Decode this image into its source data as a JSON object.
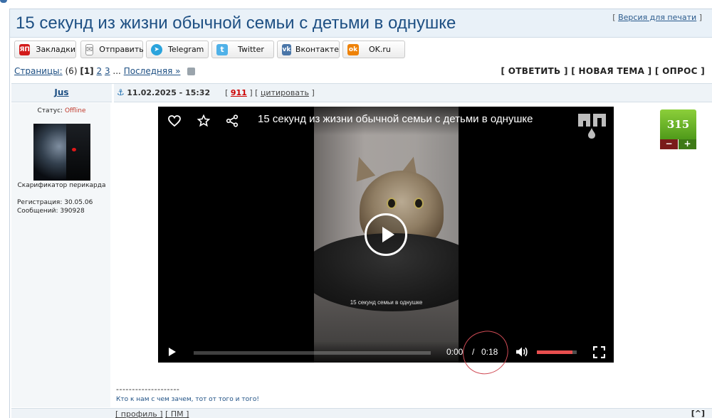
{
  "topic": {
    "title": "15 секунд из жизни обычной семьи с детьми в однушке",
    "print_bracket_open": "[",
    "print_label": "Версия для печати",
    "print_bracket_close": "]"
  },
  "share": [
    {
      "label": "Закладки",
      "icon": "yap-logo-icon",
      "icon_glyph": "ЯП",
      "color": "#d21b1b"
    },
    {
      "label": "Отправить",
      "icon": "envelope-icon",
      "icon_glyph": "✉",
      "color": "#7d7d7d"
    },
    {
      "label": "Telegram",
      "icon": "telegram-icon",
      "icon_glyph": "➤",
      "color": "#2aa3dc"
    },
    {
      "label": "Twitter",
      "icon": "twitter-icon",
      "icon_glyph": "t",
      "color": "#4fb1e8"
    },
    {
      "label": "Вконтакте",
      "icon": "vk-icon",
      "icon_glyph": "vk",
      "color": "#4a76a8"
    },
    {
      "label": "OK.ru",
      "icon": "odnoklassniki-icon",
      "icon_glyph": "ok",
      "color": "#ee8208"
    }
  ],
  "pager": {
    "label": "Страницы:",
    "count": "(6)",
    "current": "[1]",
    "page2": "2",
    "page3": "3",
    "ellipsis": "...",
    "last": "Последняя »"
  },
  "actions": "[ ОТВЕТИТЬ ] [ НОВАЯ ТЕМА ] [ ОПРОС ]",
  "post": {
    "author": "Jus",
    "anchor": "⚓",
    "date": "11.02.2025 - 15:32",
    "num_open": "[",
    "number": "911",
    "num_close": "]",
    "quote_open": "[",
    "quote_label": "цитировать",
    "quote_close": "]"
  },
  "user": {
    "status_label": "Статус:",
    "status_value": "Offline",
    "rank": "Скарификатор перикарда",
    "registration": "Регистрация: 30.05.06",
    "messages": "Сообщений: 390928"
  },
  "video": {
    "title": "15 секунд из жизни обычной семьи с детьми в однушке",
    "caption": "15 секунд семьи в однушке",
    "current_time": "0:00",
    "time_sep": "/",
    "duration": "0:18",
    "progress": 0,
    "volume": 0.9,
    "volume_color": "#e84f4f"
  },
  "rating": {
    "score": "315",
    "minus": "−",
    "plus": "+"
  },
  "signature": {
    "line": "--------------------",
    "text": "Кто к нам с чем зачем, тот от того и того!"
  },
  "footer": {
    "profile": "[ профиль ]",
    "pm": "[ ПМ ]",
    "top": "[^]"
  }
}
